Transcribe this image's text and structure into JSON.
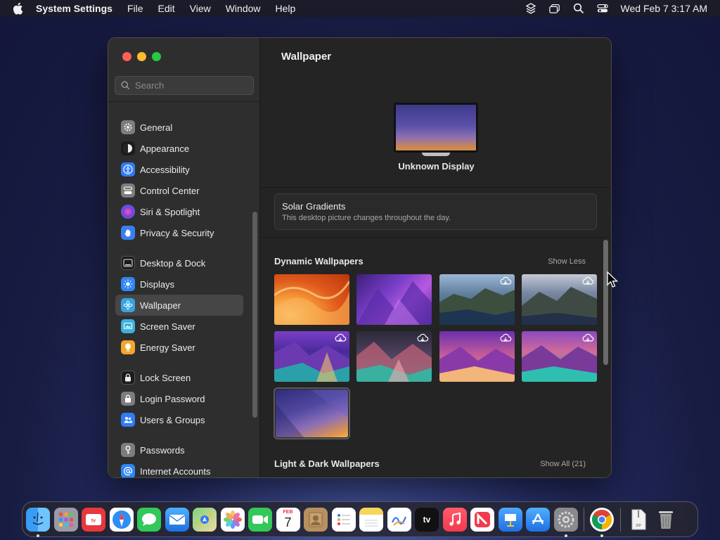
{
  "menubar": {
    "app_name": "System Settings",
    "menus": [
      "File",
      "Edit",
      "View",
      "Window",
      "Help"
    ],
    "clock": "Wed Feb 7  3:17 AM"
  },
  "sidebar": {
    "search_placeholder": "Search",
    "items": [
      {
        "label": "General",
        "icon": "gear-icon",
        "color": "#7d7d7d"
      },
      {
        "label": "Appearance",
        "icon": "appearance-icon",
        "color": "#1c1c1c"
      },
      {
        "label": "Accessibility",
        "icon": "accessibility-icon",
        "color": "#2f7cf6"
      },
      {
        "label": "Control Center",
        "icon": "control-center-icon",
        "color": "#7d7d7d"
      },
      {
        "label": "Siri & Spotlight",
        "icon": "siri-icon",
        "color": "#6a3fc9"
      },
      {
        "label": "Privacy & Security",
        "icon": "hand-icon",
        "color": "#3a7ef2"
      },
      {
        "label": "Desktop & Dock",
        "icon": "dock-icon",
        "color": "#1c1c1c"
      },
      {
        "label": "Displays",
        "icon": "sun-icon",
        "color": "#2f86f5"
      },
      {
        "label": "Wallpaper",
        "icon": "flower-icon",
        "color": "#36a4e0"
      },
      {
        "label": "Screen Saver",
        "icon": "screensaver-icon",
        "color": "#3cb2dd"
      },
      {
        "label": "Energy Saver",
        "icon": "bulb-icon",
        "color": "#f2a52f"
      },
      {
        "label": "Lock Screen",
        "icon": "lock-icon",
        "color": "#1c1c1c"
      },
      {
        "label": "Login Password",
        "icon": "padlock-icon",
        "color": "#7d7d7d"
      },
      {
        "label": "Users & Groups",
        "icon": "users-icon",
        "color": "#2f7cf6"
      },
      {
        "label": "Passwords",
        "icon": "key-icon",
        "color": "#7d7d7d"
      },
      {
        "label": "Internet Accounts",
        "icon": "at-icon",
        "color": "#2f86f5"
      }
    ],
    "active": "Wallpaper"
  },
  "content": {
    "title": "Wallpaper",
    "display_name": "Unknown Display",
    "current_wallpaper": {
      "title": "Solar Gradients",
      "subtitle": "This desktop picture changes throughout the day."
    },
    "dynamic": {
      "title": "Dynamic Wallpapers",
      "link": "Show Less"
    },
    "light_dark": {
      "title": "Light & Dark Wallpapers",
      "link": "Show All (21)"
    }
  },
  "dock": {
    "apps": [
      "Finder",
      "Launchpad",
      "TV Remote",
      "Safari",
      "Messages",
      "Mail",
      "Maps",
      "Photos",
      "FaceTime",
      "Calendar",
      "Contacts",
      "Reminders",
      "Notes",
      "Freeform",
      "TV",
      "Music",
      "News",
      "Keynote",
      "App Store",
      "System Settings",
      "Chrome",
      "Archive",
      "Trash"
    ],
    "calendar_month": "FEB",
    "calendar_day": "7",
    "tv_label": "tv"
  },
  "colors": {
    "window_bg": "#242424",
    "sidebar_bg": "#2e2e2e",
    "accent": "#2f7cf6"
  }
}
